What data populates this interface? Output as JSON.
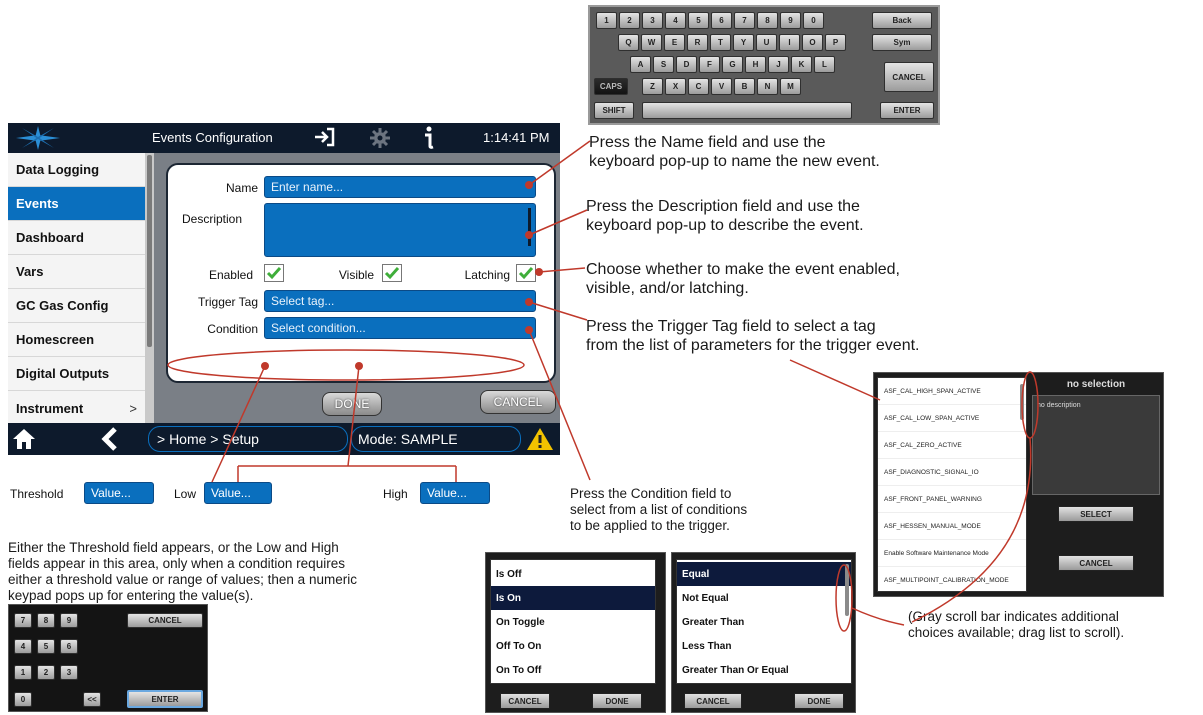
{
  "keyboard": {
    "row1": [
      "1",
      "2",
      "3",
      "4",
      "5",
      "6",
      "7",
      "8",
      "9",
      "0",
      "Back"
    ],
    "row2": [
      "Q",
      "W",
      "E",
      "R",
      "T",
      "Y",
      "U",
      "I",
      "O",
      "P",
      "Sym"
    ],
    "row3": [
      "A",
      "S",
      "D",
      "F",
      "G",
      "H",
      "J",
      "K",
      "L",
      "CANCEL"
    ],
    "row4": [
      "CAPS",
      "Z",
      "X",
      "C",
      "V",
      "B",
      "N",
      "M"
    ],
    "shift": "SHIFT",
    "enter": "ENTER"
  },
  "header": {
    "title": "Events Configuration",
    "time": "1:14:41 PM"
  },
  "sidebar": {
    "items": [
      {
        "label": "Data Logging",
        "active": false
      },
      {
        "label": "Events",
        "active": true
      },
      {
        "label": "Dashboard",
        "active": false
      },
      {
        "label": "Vars",
        "active": false
      },
      {
        "label": "GC Gas Config",
        "active": false
      },
      {
        "label": "Homescreen",
        "active": false
      },
      {
        "label": "Digital Outputs",
        "active": false
      },
      {
        "label": "Instrument",
        "active": false,
        "chevron": ">"
      }
    ]
  },
  "form": {
    "name_label": "Name",
    "name_placeholder": "Enter name...",
    "description_label": "Description",
    "enabled_label": "Enabled",
    "visible_label": "Visible",
    "latching_label": "Latching",
    "enabled": true,
    "visible": true,
    "latching": true,
    "trigger_label": "Trigger Tag",
    "trigger_placeholder": "Select tag...",
    "condition_label": "Condition",
    "condition_placeholder": "Select condition...",
    "done_label": "DONE",
    "cancel_label": "CANCEL"
  },
  "bottom": {
    "breadcrumb": "> Home > Setup",
    "mode": "Mode: SAMPLE"
  },
  "annotations": {
    "name": [
      "Press the Name field and use the",
      "keyboard pop-up to name the new event."
    ],
    "description": [
      "Press the Description field and use the",
      "keyboard pop-up to describe the event."
    ],
    "checks": [
      "Choose whether to make the event enabled,",
      "visible, and/or latching."
    ],
    "trigger": [
      "Press the Trigger Tag field to select a tag",
      "from the list of parameters for the trigger event."
    ],
    "condition": [
      "Press the Condition field to",
      "select from a list of conditions",
      "to be applied to the trigger."
    ],
    "area": [
      "Either the Threshold field appears, or the Low and High",
      "fields appear in this area, only when a condition requires",
      "either a threshold value or range of values; then a numeric",
      "keypad pops up for entering the value(s)."
    ],
    "scroll": [
      "(Gray scroll bar indicates additional",
      "choices available; drag list to scroll)."
    ]
  },
  "threshold": {
    "threshold_label": "Threshold",
    "low_label": "Low",
    "high_label": "High",
    "value_placeholder": "Value..."
  },
  "keypad": {
    "keys": [
      "7",
      "8",
      "9",
      "4",
      "5",
      "6",
      "1",
      "2",
      "3",
      "0",
      "<<"
    ],
    "cancel": "CANCEL",
    "enter": "ENTER"
  },
  "state_list": {
    "items": [
      "Is Off",
      "Is On",
      "On Toggle",
      "Off To On",
      "On To Off"
    ],
    "selected": "Is On",
    "cancel": "CANCEL",
    "done": "DONE"
  },
  "condition_list": {
    "items": [
      "Equal",
      "Not Equal",
      "Greater Than",
      "Less Than",
      "Greater Than Or Equal"
    ],
    "selected": "Equal",
    "cancel": "CANCEL",
    "done": "DONE"
  },
  "tag_list": {
    "items": [
      "ASF_CAL_HIGH_SPAN_ACTIVE",
      "ASF_CAL_LOW_SPAN_ACTIVE",
      "ASF_CAL_ZERO_ACTIVE",
      "ASF_DIAGNOSTIC_SIGNAL_IO",
      "ASF_FRONT_PANEL_WARNING",
      "ASF_HESSEN_MANUAL_MODE",
      "Enable Software Maintenance Mode",
      "ASF_MULTIPOINT_CALIBRATION_MODE"
    ],
    "header": "no selection",
    "description": "no description",
    "select": "SELECT",
    "cancel": "CANCEL"
  },
  "colors": {
    "accent_blue": "#0a6fbe",
    "dark_navy": "#0d1a2c",
    "annotation_red": "#c0392b",
    "check_green": "#3fae3a",
    "warning_yellow": "#f2c200"
  }
}
